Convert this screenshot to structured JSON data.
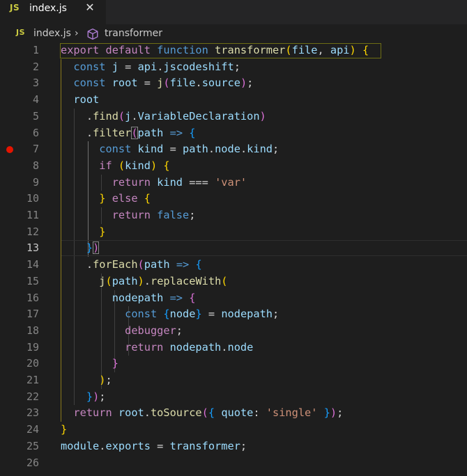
{
  "tab": {
    "badge": "JS",
    "label": "index.js",
    "close_glyph": "✕"
  },
  "breadcrumb": {
    "badge": "JS",
    "file": "index.js",
    "separator": "›",
    "symbol_icon": "cube-icon",
    "symbol": "transformer"
  },
  "editor": {
    "breakpoint_line": 7,
    "current_line": 13,
    "lines": [
      {
        "n": "1",
        "parts": [
          [
            "kw",
            "export"
          ],
          [
            "op",
            " "
          ],
          [
            "kw",
            "default"
          ],
          [
            "op",
            " "
          ],
          [
            "st",
            "function"
          ],
          [
            "op",
            " "
          ],
          [
            "fn",
            "transformer"
          ],
          [
            "b1",
            "("
          ],
          [
            "vr",
            "file"
          ],
          [
            "op",
            ", "
          ],
          [
            "vr",
            "api"
          ],
          [
            "b1",
            ")"
          ],
          [
            "op",
            " "
          ],
          [
            "b1",
            "{"
          ]
        ]
      },
      {
        "n": "2",
        "parts": [
          [
            "op",
            "  "
          ],
          [
            "st",
            "const"
          ],
          [
            "op",
            " "
          ],
          [
            "vr",
            "j"
          ],
          [
            "op",
            " = "
          ],
          [
            "vr",
            "api"
          ],
          [
            "op",
            "."
          ],
          [
            "vr",
            "jscodeshift"
          ],
          [
            "op",
            ";"
          ]
        ]
      },
      {
        "n": "3",
        "parts": [
          [
            "op",
            "  "
          ],
          [
            "st",
            "const"
          ],
          [
            "op",
            " "
          ],
          [
            "vr",
            "root"
          ],
          [
            "op",
            " = "
          ],
          [
            "fn",
            "j"
          ],
          [
            "b2",
            "("
          ],
          [
            "vr",
            "file"
          ],
          [
            "op",
            "."
          ],
          [
            "vr",
            "source"
          ],
          [
            "b2",
            ")"
          ],
          [
            "op",
            ";"
          ]
        ]
      },
      {
        "n": "4",
        "parts": [
          [
            "op",
            "  "
          ],
          [
            "vr",
            "root"
          ]
        ]
      },
      {
        "n": "5",
        "parts": [
          [
            "op",
            "    ."
          ],
          [
            "fn",
            "find"
          ],
          [
            "b2",
            "("
          ],
          [
            "vr",
            "j"
          ],
          [
            "op",
            "."
          ],
          [
            "vr",
            "VariableDeclaration"
          ],
          [
            "b2",
            ")"
          ]
        ]
      },
      {
        "n": "6",
        "parts": [
          [
            "op",
            "    ."
          ],
          [
            "fn",
            "filter"
          ],
          [
            "b2m",
            "("
          ],
          [
            "vr",
            "path"
          ],
          [
            "op",
            " "
          ],
          [
            "st",
            "=>"
          ],
          [
            "op",
            " "
          ],
          [
            "b3",
            "{"
          ]
        ]
      },
      {
        "n": "7",
        "parts": [
          [
            "op",
            "      "
          ],
          [
            "st",
            "const"
          ],
          [
            "op",
            " "
          ],
          [
            "vr",
            "kind"
          ],
          [
            "op",
            " = "
          ],
          [
            "vr",
            "path"
          ],
          [
            "op",
            "."
          ],
          [
            "vr",
            "node"
          ],
          [
            "op",
            "."
          ],
          [
            "vr",
            "kind"
          ],
          [
            "op",
            ";"
          ]
        ]
      },
      {
        "n": "8",
        "parts": [
          [
            "op",
            "      "
          ],
          [
            "kw",
            "if"
          ],
          [
            "op",
            " "
          ],
          [
            "b1",
            "("
          ],
          [
            "vr",
            "kind"
          ],
          [
            "b1",
            ")"
          ],
          [
            "op",
            " "
          ],
          [
            "b1",
            "{"
          ]
        ]
      },
      {
        "n": "9",
        "parts": [
          [
            "op",
            "        "
          ],
          [
            "kw",
            "return"
          ],
          [
            "op",
            " "
          ],
          [
            "vr",
            "kind"
          ],
          [
            "op",
            " === "
          ],
          [
            "str",
            "'var'"
          ]
        ]
      },
      {
        "n": "10",
        "parts": [
          [
            "op",
            "      "
          ],
          [
            "b1",
            "}"
          ],
          [
            "op",
            " "
          ],
          [
            "kw",
            "else"
          ],
          [
            "op",
            " "
          ],
          [
            "b1",
            "{"
          ]
        ]
      },
      {
        "n": "11",
        "parts": [
          [
            "op",
            "        "
          ],
          [
            "kw",
            "return"
          ],
          [
            "op",
            " "
          ],
          [
            "st",
            "false"
          ],
          [
            "op",
            ";"
          ]
        ]
      },
      {
        "n": "12",
        "parts": [
          [
            "op",
            "      "
          ],
          [
            "b1",
            "}"
          ]
        ]
      },
      {
        "n": "13",
        "parts": [
          [
            "op",
            "    "
          ],
          [
            "b3",
            "}"
          ],
          [
            "b2m",
            ")"
          ]
        ]
      },
      {
        "n": "14",
        "parts": [
          [
            "op",
            "    ."
          ],
          [
            "fn",
            "forEach"
          ],
          [
            "b2",
            "("
          ],
          [
            "vr",
            "path"
          ],
          [
            "op",
            " "
          ],
          [
            "st",
            "=>"
          ],
          [
            "op",
            " "
          ],
          [
            "b3",
            "{"
          ]
        ]
      },
      {
        "n": "15",
        "parts": [
          [
            "op",
            "      "
          ],
          [
            "fn",
            "j"
          ],
          [
            "b1",
            "("
          ],
          [
            "vr",
            "path"
          ],
          [
            "b1",
            ")"
          ],
          [
            "op",
            "."
          ],
          [
            "fn",
            "replaceWith"
          ],
          [
            "b1",
            "("
          ]
        ]
      },
      {
        "n": "16",
        "parts": [
          [
            "op",
            "        "
          ],
          [
            "vr",
            "nodepath"
          ],
          [
            "op",
            " "
          ],
          [
            "st",
            "=>"
          ],
          [
            "op",
            " "
          ],
          [
            "b2",
            "{"
          ]
        ]
      },
      {
        "n": "17",
        "parts": [
          [
            "op",
            "          "
          ],
          [
            "st",
            "const"
          ],
          [
            "op",
            " "
          ],
          [
            "b3",
            "{"
          ],
          [
            "vr",
            "node"
          ],
          [
            "b3",
            "}"
          ],
          [
            "op",
            " = "
          ],
          [
            "vr",
            "nodepath"
          ],
          [
            "op",
            ";"
          ]
        ]
      },
      {
        "n": "18",
        "parts": [
          [
            "op",
            "          "
          ],
          [
            "kw",
            "debugger"
          ],
          [
            "op",
            ";"
          ]
        ]
      },
      {
        "n": "19",
        "parts": [
          [
            "op",
            "          "
          ],
          [
            "kw",
            "return"
          ],
          [
            "op",
            " "
          ],
          [
            "vr",
            "nodepath"
          ],
          [
            "op",
            "."
          ],
          [
            "vr",
            "node"
          ]
        ]
      },
      {
        "n": "20",
        "parts": [
          [
            "op",
            "        "
          ],
          [
            "b2",
            "}"
          ]
        ]
      },
      {
        "n": "21",
        "parts": [
          [
            "op",
            "      "
          ],
          [
            "b1",
            ")"
          ],
          [
            "op",
            ";"
          ]
        ]
      },
      {
        "n": "22",
        "parts": [
          [
            "op",
            "    "
          ],
          [
            "b3",
            "}"
          ],
          [
            "b2",
            ")"
          ],
          [
            "op",
            ";"
          ]
        ]
      },
      {
        "n": "23",
        "parts": [
          [
            "op",
            "  "
          ],
          [
            "kw",
            "return"
          ],
          [
            "op",
            " "
          ],
          [
            "vr",
            "root"
          ],
          [
            "op",
            "."
          ],
          [
            "fn",
            "toSource"
          ],
          [
            "b2",
            "("
          ],
          [
            "b3",
            "{"
          ],
          [
            "op",
            " "
          ],
          [
            "vr",
            "quote"
          ],
          [
            "op",
            ": "
          ],
          [
            "str",
            "'single'"
          ],
          [
            "op",
            " "
          ],
          [
            "b3",
            "}"
          ],
          [
            "b2",
            ")"
          ],
          [
            "op",
            ";"
          ]
        ]
      },
      {
        "n": "24",
        "parts": [
          [
            "b1",
            "}"
          ]
        ]
      },
      {
        "n": "25",
        "parts": [
          [
            "vr",
            "module"
          ],
          [
            "op",
            "."
          ],
          [
            "vr",
            "exports"
          ],
          [
            "op",
            " = "
          ],
          [
            "vr",
            "transformer"
          ],
          [
            "op",
            ";"
          ]
        ]
      },
      {
        "n": "26",
        "parts": []
      }
    ]
  }
}
